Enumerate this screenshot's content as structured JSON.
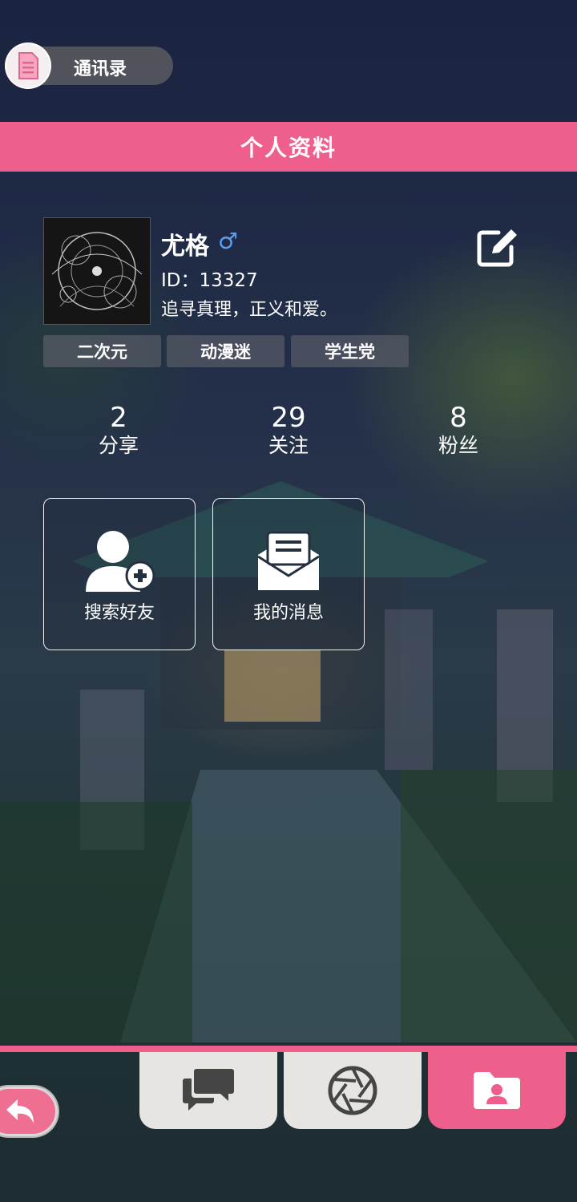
{
  "top_button": {
    "label": "通讯录",
    "icon": "contacts-doc-icon"
  },
  "banner": {
    "title": "个人资料"
  },
  "profile": {
    "name": "尤格",
    "gender_symbol": "♂",
    "id_text": "ID：13327",
    "bio": "追寻真理，正义和爱。",
    "tags": [
      "二次元",
      "动漫迷",
      "学生党"
    ]
  },
  "stats": [
    {
      "value": "2",
      "label": "分享"
    },
    {
      "value": "29",
      "label": "关注"
    },
    {
      "value": "8",
      "label": "粉丝"
    }
  ],
  "cards": [
    {
      "label": "搜索好友",
      "icon": "add-user-icon"
    },
    {
      "label": "我的消息",
      "icon": "envelope-icon"
    }
  ],
  "nav": {
    "tabs": [
      {
        "icon": "chat-bubbles-icon",
        "active": false
      },
      {
        "icon": "aperture-icon",
        "active": false
      },
      {
        "icon": "profile-folder-icon",
        "active": true
      }
    ],
    "back_icon": "back-arrow-icon"
  },
  "colors": {
    "accent": "#ef5f8c",
    "tab_bg": "#e7e5e2",
    "gender": "#5aa0ef"
  }
}
